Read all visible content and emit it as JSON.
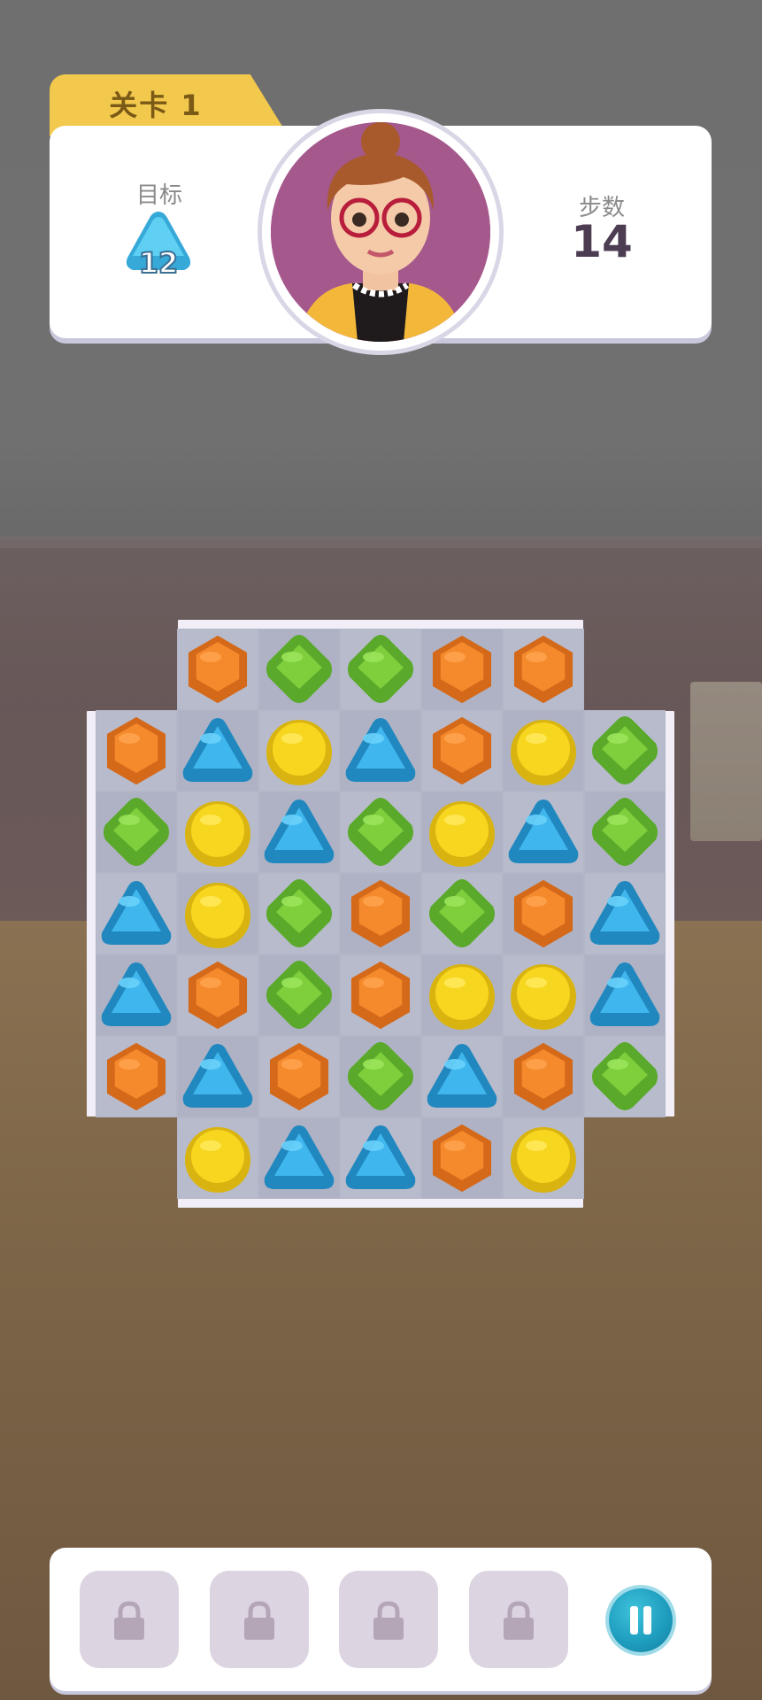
{
  "header": {
    "level_label": "关卡 1",
    "goal_label": "目标",
    "goal_gem": "blue-triangle",
    "goal_count": "12",
    "moves_label": "步数",
    "moves_value": "14"
  },
  "gem_colors": {
    "O": "#f48a2c",
    "G": "#7fce3c",
    "Y": "#f7d61f",
    "B": "#3fb7ee"
  },
  "board": {
    "rows": [
      [
        null,
        "O",
        "G",
        "G",
        "O",
        "O",
        null
      ],
      [
        "O",
        "B",
        "Y",
        "B",
        "O",
        "Y",
        "G"
      ],
      [
        "G",
        "Y",
        "B",
        "G",
        "Y",
        "B",
        "G"
      ],
      [
        "B",
        "Y",
        "G",
        "O",
        "G",
        "O",
        "B"
      ],
      [
        "B",
        "O",
        "G",
        "O",
        "Y",
        "Y",
        "B"
      ],
      [
        "O",
        "B",
        "O",
        "G",
        "B",
        "O",
        "G"
      ],
      [
        null,
        "Y",
        "B",
        "B",
        "O",
        "Y",
        null
      ]
    ]
  },
  "boosters": [
    {
      "state": "locked",
      "icon": "lock-icon"
    },
    {
      "state": "locked",
      "icon": "lock-icon"
    },
    {
      "state": "locked",
      "icon": "lock-icon"
    },
    {
      "state": "locked",
      "icon": "lock-icon"
    }
  ],
  "pause_icon": "pause-icon"
}
